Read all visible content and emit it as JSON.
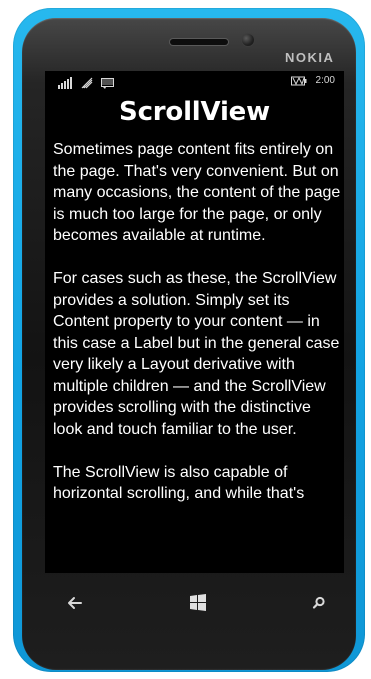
{
  "device": {
    "brand": "NOKIA"
  },
  "status_bar": {
    "time": "2:00",
    "icons": [
      "signal-icon",
      "wifi-icon",
      "message-icon",
      "battery-icon"
    ]
  },
  "page": {
    "title": "ScrollView",
    "content": "Sometimes page content fits entirely on the page. That's very convenient. But on many occasions, the content of the page is much too large for the page, or only becomes available at runtime.\n\nFor cases such as these, the ScrollView provides a solution. Simply set its Content property to your content — in this case a Label but in the general case very likely a Layout derivative with multiple children — and the ScrollView provides scrolling with the distinctive look and touch familiar to the user.\n\nThe ScrollView is also capable of horizontal scrolling, and while that's"
  },
  "nav_bar": {
    "buttons": [
      "back-icon",
      "windows-start-icon",
      "search-icon"
    ]
  },
  "colors": {
    "shell_blue": "#12a3e3",
    "phone_black": "#131313",
    "screen_black": "#000000",
    "text_white": "#ffffff"
  }
}
